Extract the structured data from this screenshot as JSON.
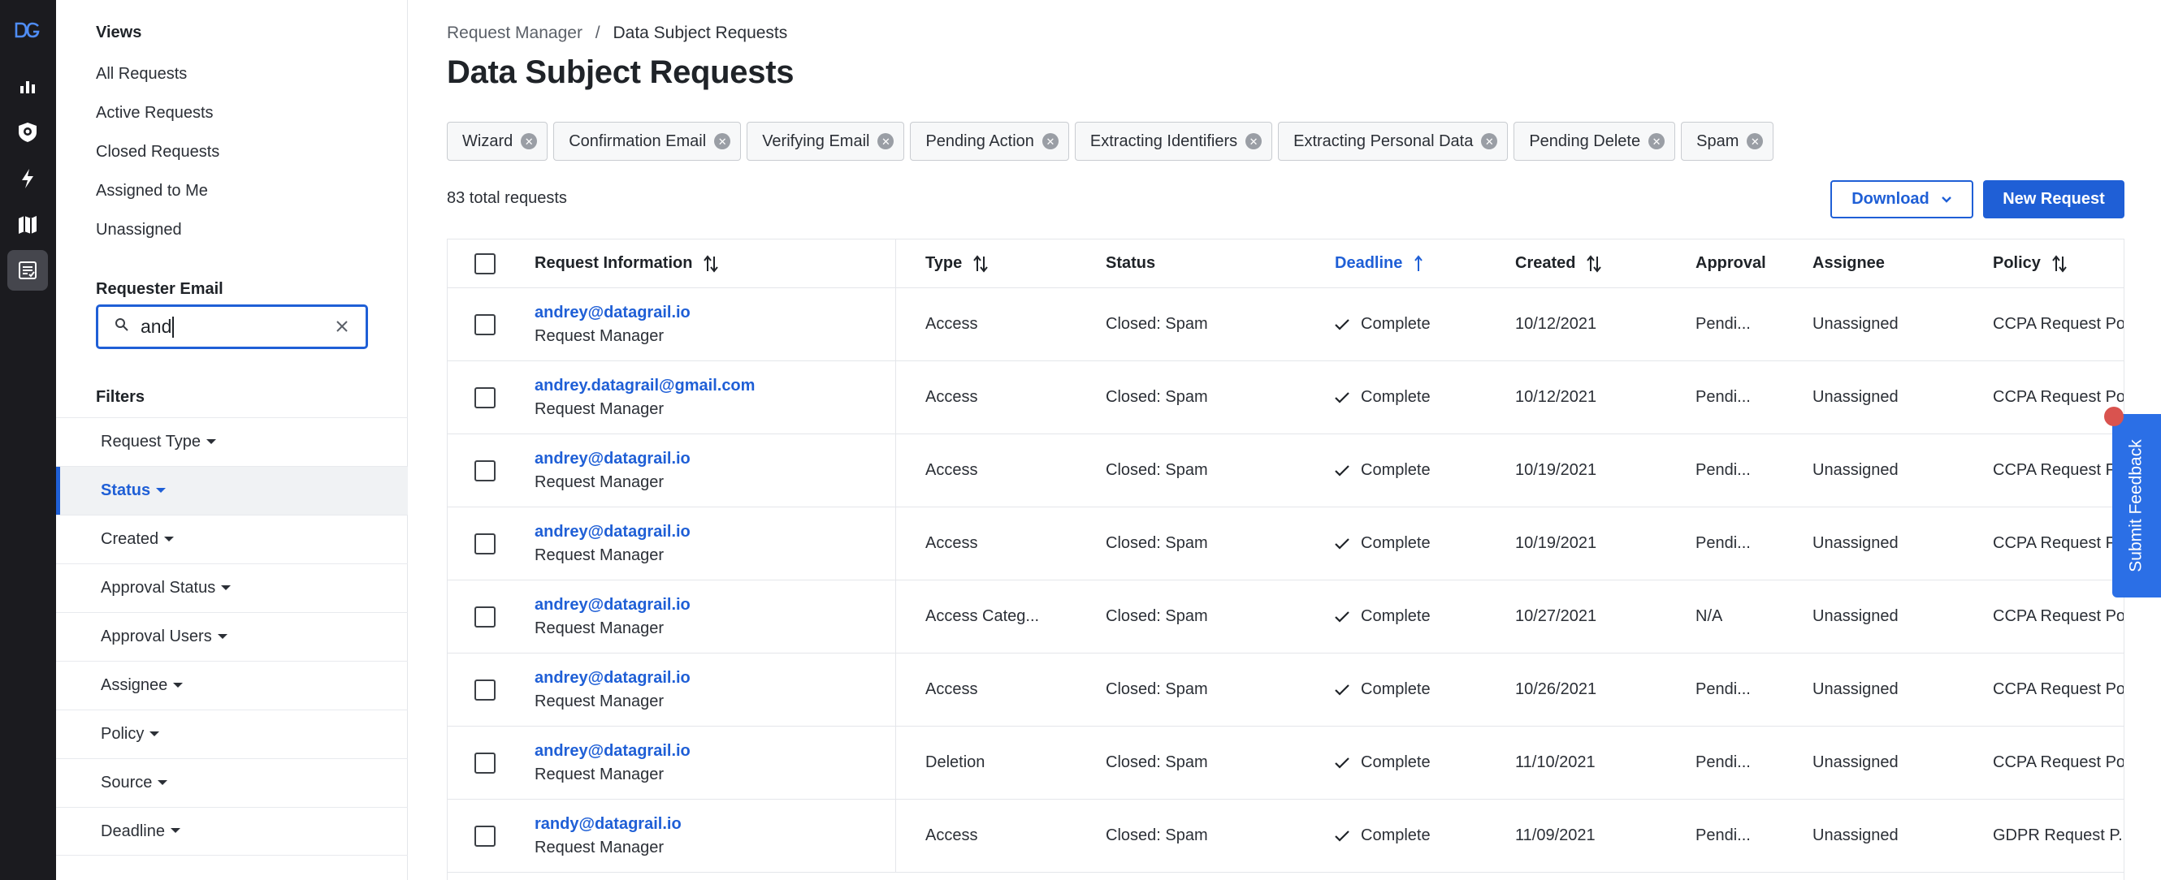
{
  "rail": {
    "icons": [
      "datagrail-logo-icon",
      "bar-chart-icon",
      "shield-icon",
      "bolt-icon",
      "map-icon",
      "requests-list-icon"
    ]
  },
  "sidebar": {
    "views_heading": "Views",
    "views": [
      "All Requests",
      "Active Requests",
      "Closed Requests",
      "Assigned to Me",
      "Unassigned"
    ],
    "email_heading": "Requester Email",
    "search_value": "and",
    "filters_heading": "Filters",
    "filters": [
      "Request Type",
      "Status",
      "Created",
      "Approval Status",
      "Approval Users",
      "Assignee",
      "Policy",
      "Source",
      "Deadline"
    ],
    "active_filter": "Status"
  },
  "breadcrumb": {
    "parent": "Request Manager",
    "separator": "/",
    "current": "Data Subject Requests"
  },
  "page_title": "Data Subject Requests",
  "chips": [
    "Wizard",
    "Confirmation Email",
    "Verifying Email",
    "Pending Action",
    "Extracting Identifiers",
    "Extracting Personal Data",
    "Pending Delete",
    "Spam"
  ],
  "total_text": "83 total requests",
  "buttons": {
    "download": "Download",
    "new_request": "New Request"
  },
  "table": {
    "headers": {
      "request_info": "Request Information",
      "type": "Type",
      "status": "Status",
      "deadline": "Deadline",
      "created": "Created",
      "approval": "Approval",
      "assignee": "Assignee",
      "policy": "Policy"
    },
    "rows": [
      {
        "email": "andrey@datagrail.io",
        "source": "Request Manager",
        "type": "Access",
        "status": "Closed: Spam",
        "deadline": "Complete",
        "created": "10/12/2021",
        "approval": "Pendi...",
        "assignee": "Unassigned",
        "policy": "CCPA Request Po"
      },
      {
        "email": "andrey.datagrail@gmail.com",
        "source": "Request Manager",
        "type": "Access",
        "status": "Closed: Spam",
        "deadline": "Complete",
        "created": "10/12/2021",
        "approval": "Pendi...",
        "assignee": "Unassigned",
        "policy": "CCPA Request Po"
      },
      {
        "email": "andrey@datagrail.io",
        "source": "Request Manager",
        "type": "Access",
        "status": "Closed: Spam",
        "deadline": "Complete",
        "created": "10/19/2021",
        "approval": "Pendi...",
        "assignee": "Unassigned",
        "policy": "CCPA Request F"
      },
      {
        "email": "andrey@datagrail.io",
        "source": "Request Manager",
        "type": "Access",
        "status": "Closed: Spam",
        "deadline": "Complete",
        "created": "10/19/2021",
        "approval": "Pendi...",
        "assignee": "Unassigned",
        "policy": "CCPA Request F"
      },
      {
        "email": "andrey@datagrail.io",
        "source": "Request Manager",
        "type": "Access Categ...",
        "status": "Closed: Spam",
        "deadline": "Complete",
        "created": "10/27/2021",
        "approval": "N/A",
        "assignee": "Unassigned",
        "policy": "CCPA Request Po"
      },
      {
        "email": "andrey@datagrail.io",
        "source": "Request Manager",
        "type": "Access",
        "status": "Closed: Spam",
        "deadline": "Complete",
        "created": "10/26/2021",
        "approval": "Pendi...",
        "assignee": "Unassigned",
        "policy": "CCPA Request Po"
      },
      {
        "email": "andrey@datagrail.io",
        "source": "Request Manager",
        "type": "Deletion",
        "status": "Closed: Spam",
        "deadline": "Complete",
        "created": "11/10/2021",
        "approval": "Pendi...",
        "assignee": "Unassigned",
        "policy": "CCPA Request Po"
      },
      {
        "email": "randy@datagrail.io",
        "source": "Request Manager",
        "type": "Access",
        "status": "Closed: Spam",
        "deadline": "Complete",
        "created": "11/09/2021",
        "approval": "Pendi...",
        "assignee": "Unassigned",
        "policy": "GDPR Request P..."
      }
    ]
  },
  "feedback": "Submit Feedback",
  "colors": {
    "accent": "#1f5fd6",
    "rail": "#1b1b1f",
    "feedback": "#2b6fe6",
    "notify": "#d9534f"
  }
}
